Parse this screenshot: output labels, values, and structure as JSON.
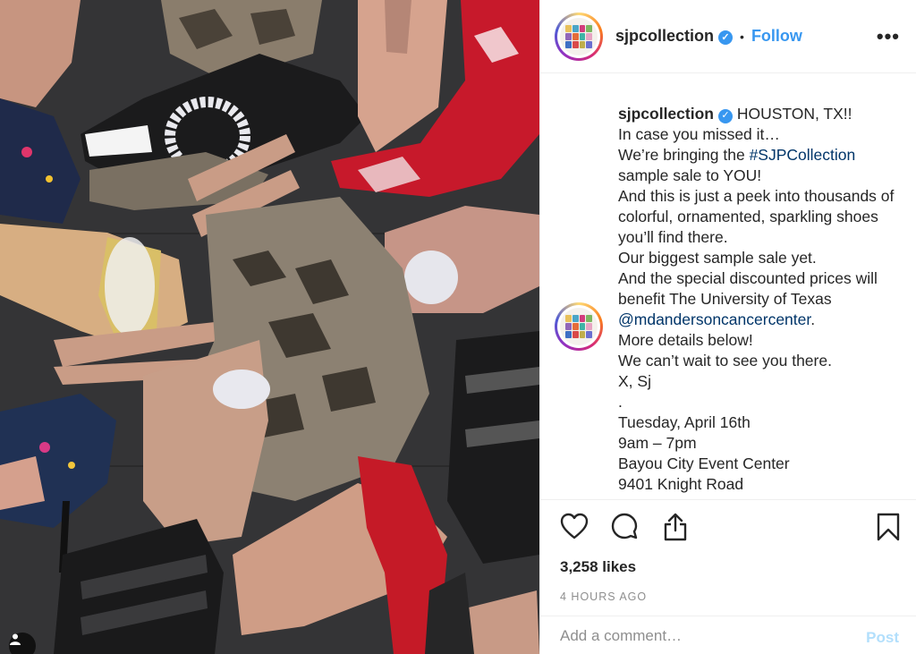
{
  "post": {
    "username": "sjpcollection",
    "verified_icon": "verified-badge-icon",
    "follow_label": "Follow",
    "more_icon": "more-options-icon",
    "more_label": "•••",
    "separator": "•"
  },
  "caption": {
    "username": "sjpcollection",
    "line1": "HOUSTON, TX!!",
    "line2": "In case you missed it…",
    "line3_pre": "We’re bringing the ",
    "hashtag": "#SJPCollection",
    "line4": "sample sale to YOU!",
    "line5": "And this is just a peek into thousands of colorful, ornamented, sparkling shoes you’ll find there.",
    "line6": "Our biggest sample sale yet.",
    "line7": "And the special discounted prices will benefit The University of Texas",
    "mention": "@mdandersoncancercenter",
    "mention_suffix": ".",
    "line8": "More details below!",
    "line9": "We can’t wait to see you there.",
    "line10": "X, Sj",
    "line11": ".",
    "line12": "Tuesday, April 16th",
    "line13": "9am – 7pm",
    "line14": "Bayou City Event Center",
    "line15": "9401 Knight Road"
  },
  "actions": {
    "like_icon": "heart-icon",
    "comment_icon": "comment-icon",
    "share_icon": "share-icon",
    "save_icon": "bookmark-icon",
    "likes": "3,258 likes",
    "time": "4 HOURS AGO"
  },
  "comment": {
    "placeholder": "Add a comment…",
    "post_label": "Post"
  },
  "colors": {
    "accent": "#3897f0",
    "link": "#003569",
    "muted": "#8e8e8e",
    "post_disabled": "#b2dffc"
  }
}
